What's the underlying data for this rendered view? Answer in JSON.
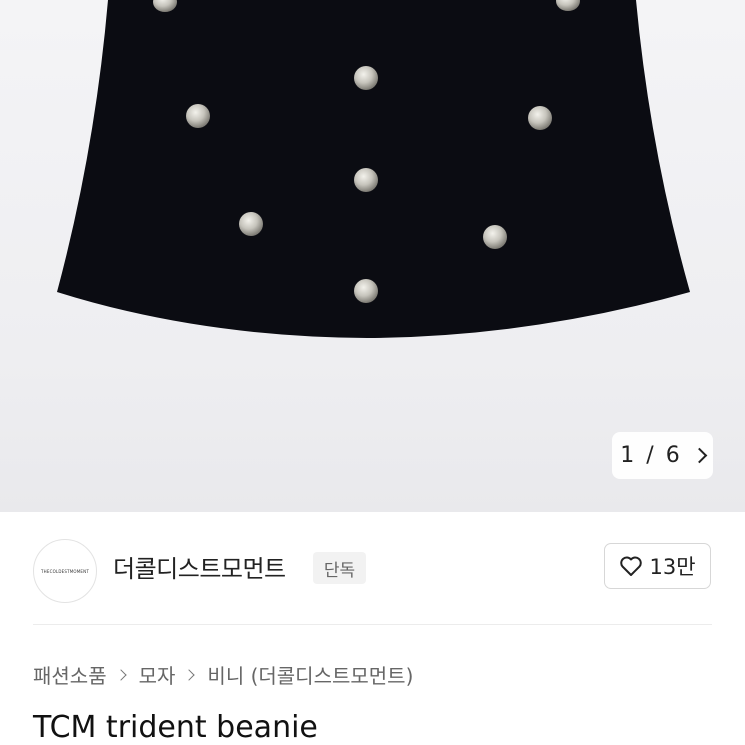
{
  "product_image": {
    "icon": "beanie-photo",
    "counter_current": "1",
    "counter_separator": "/",
    "counter_total": "6",
    "next_icon": "chevron-right-icon"
  },
  "shop": {
    "logo_text": "THECOLDESTMOMENT",
    "name": "더콜디스트모먼트",
    "badge": "단독",
    "like_icon": "heart-outline-icon",
    "like_count": "13만"
  },
  "breadcrumb": [
    "패션소품",
    "모자",
    "비니 (더콜디스트모먼트)"
  ],
  "product": {
    "title": "TCM trident beanie"
  },
  "colors": {
    "beanie": "#0b0c12",
    "stud": "#c9c8c1",
    "background": "#f1f1f3"
  }
}
